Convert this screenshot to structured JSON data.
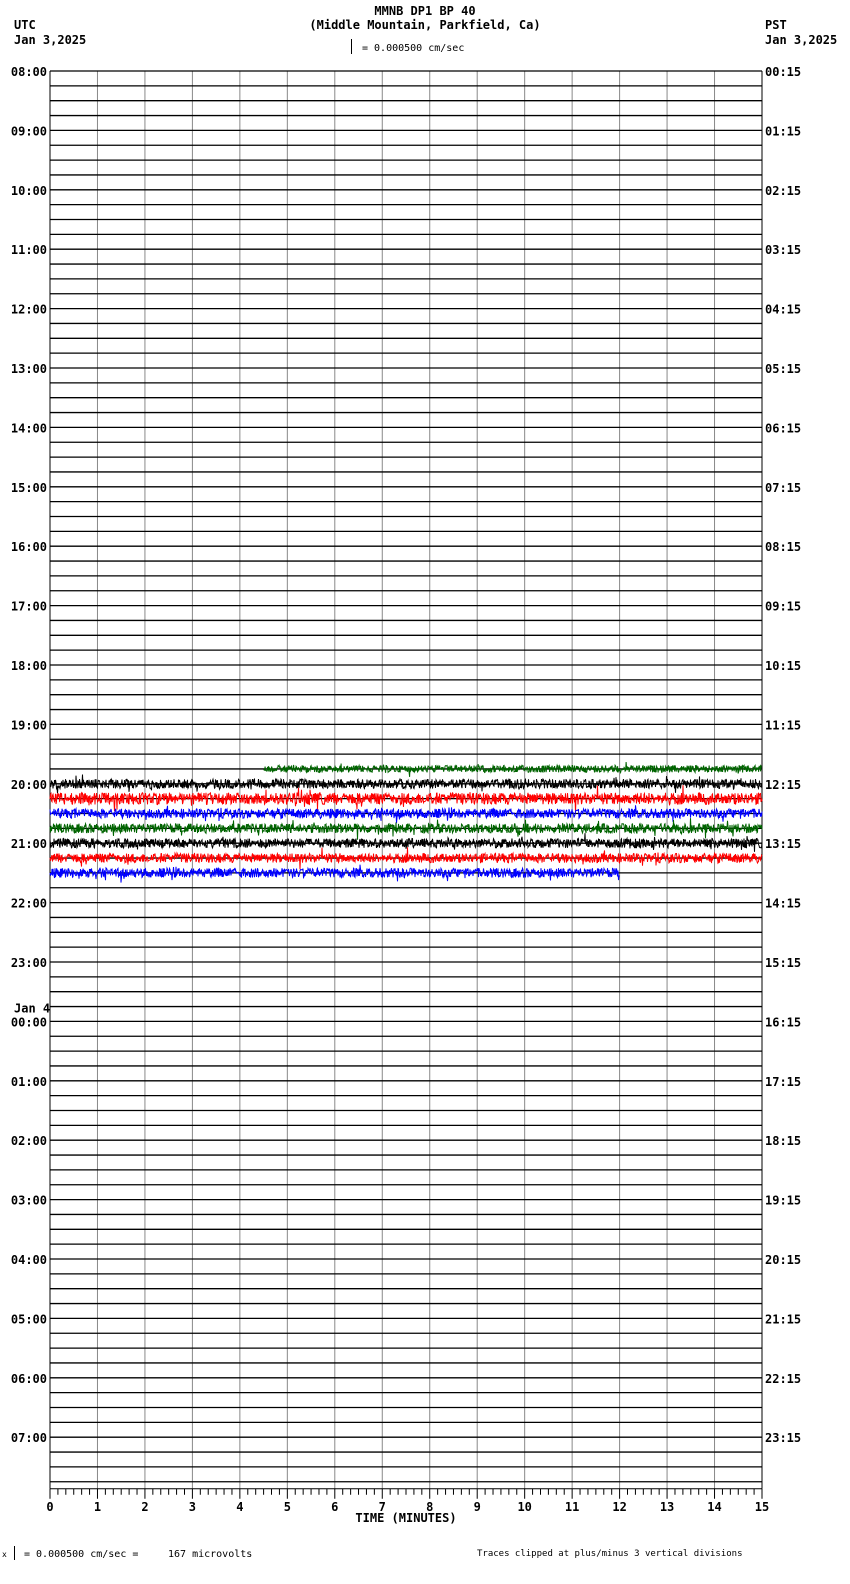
{
  "header": {
    "title": "MMNB DP1 BP 40",
    "subtitle": "(Middle Mountain, Parkfield, Ca)",
    "left_tz": "UTC",
    "left_date": "Jan 3,2025",
    "right_tz": "PST",
    "right_date": "Jan 3,2025",
    "scale": "= 0.000500 cm/sec"
  },
  "footer": {
    "scale_prefix": "x",
    "scale": "= 0.000500 cm/sec =",
    "microvolts": "167 microvolts",
    "clip_note": "Traces clipped at plus/minus 3 vertical divisions"
  },
  "chart_data": {
    "type": "line",
    "title": "MMNB DP1 BP 40",
    "xlabel": "TIME (MINUTES)",
    "xlim": [
      0,
      15
    ],
    "x_ticks": [
      "0",
      "1",
      "2",
      "3",
      "4",
      "5",
      "6",
      "7",
      "8",
      "9",
      "10",
      "11",
      "12",
      "13",
      "14",
      "15"
    ],
    "rows_per_hour": 4,
    "total_rows": 96,
    "left_labels": [
      "08:00",
      "09:00",
      "10:00",
      "11:00",
      "12:00",
      "13:00",
      "14:00",
      "15:00",
      "16:00",
      "17:00",
      "18:00",
      "19:00",
      "20:00",
      "21:00",
      "22:00",
      "23:00",
      "00:00",
      "01:00",
      "02:00",
      "03:00",
      "04:00",
      "05:00",
      "06:00",
      "07:00"
    ],
    "day_change_label": "Jan 4",
    "right_labels": [
      "00:15",
      "01:15",
      "02:15",
      "03:15",
      "04:15",
      "05:15",
      "06:15",
      "07:15",
      "08:15",
      "09:15",
      "10:15",
      "11:15",
      "12:15",
      "13:15",
      "14:15",
      "15:15",
      "16:15",
      "17:15",
      "18:15",
      "19:15",
      "20:15",
      "21:15",
      "22:15",
      "23:15"
    ],
    "traces": [
      {
        "row": 47,
        "utc": "19:45",
        "start_min": 4.5,
        "end_min": 15,
        "color": "#006400",
        "amplitude": 0.15
      },
      {
        "row": 48,
        "utc": "20:00",
        "start_min": 0,
        "end_min": 15,
        "color": "#000000",
        "amplitude": 0.2
      },
      {
        "row": 49,
        "utc": "20:15",
        "start_min": 0,
        "end_min": 15,
        "color": "#ff0000",
        "amplitude": 0.25
      },
      {
        "row": 50,
        "utc": "20:30",
        "start_min": 0,
        "end_min": 15,
        "color": "#0000ff",
        "amplitude": 0.2
      },
      {
        "row": 51,
        "utc": "20:45",
        "start_min": 0,
        "end_min": 15,
        "color": "#006400",
        "amplitude": 0.2
      },
      {
        "row": 52,
        "utc": "21:00",
        "start_min": 0,
        "end_min": 15,
        "color": "#000000",
        "amplitude": 0.2
      },
      {
        "row": 53,
        "utc": "21:15",
        "start_min": 0,
        "end_min": 15,
        "color": "#ff0000",
        "amplitude": 0.2
      },
      {
        "row": 54,
        "utc": "21:30",
        "start_min": 0,
        "end_min": 12,
        "color": "#0000ff",
        "amplitude": 0.2
      }
    ]
  }
}
